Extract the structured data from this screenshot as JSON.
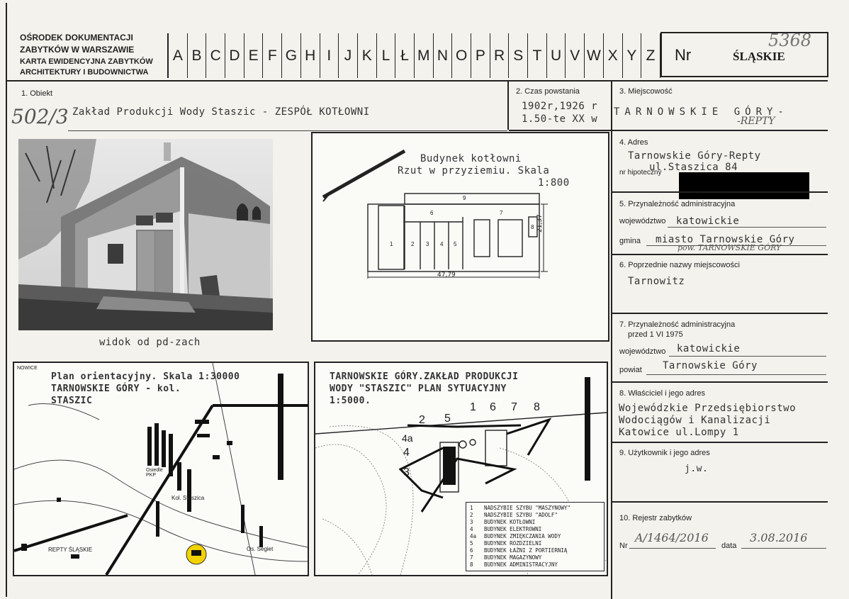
{
  "header": {
    "institution_lines": [
      "OŚRODEK DOKUMENTACJI",
      "ZABYTKÓW W WARSZAWIE",
      "KARTA EWIDENCYJNA ZABYTKÓW",
      "ARCHITEKTURY I BUDOWNICTWA"
    ],
    "alphabet": [
      "A",
      "B",
      "C",
      "D",
      "E",
      "F",
      "G",
      "H",
      "I",
      "J",
      "K",
      "L",
      "Ł",
      "M",
      "N",
      "O",
      "P",
      "R",
      "S",
      "T",
      "U",
      "V",
      "W",
      "X",
      "Y",
      "Z"
    ],
    "nr_label": "Nr",
    "region": "ŚLĄSKIE",
    "number_handwritten": "5368"
  },
  "fields": {
    "obiekt": {
      "label": "1. Obiekt",
      "value": "Zakład Produkcji Wody Staszic -  ZESPÓŁ  KOTŁOWNI",
      "handwritten_number": "502/3"
    },
    "czas": {
      "label": "2. Czas powstania",
      "line1": "1902r,1926 r",
      "line2": "1.50-te XX w"
    },
    "miejscowosc": {
      "label": "3. Miejscowość",
      "value": "TARNOWSKIE  GÓRY-",
      "handwritten": "-REPTY"
    },
    "adres": {
      "label": "4. Adres",
      "line1": "Tarnowskie Góry-Repty",
      "line2": "ul.Staszica 84",
      "hipoteczny_label": "nr hipoteczny"
    },
    "przynaleznosc": {
      "label": "5. Przynależność administracyjna",
      "wojewodztwo_label": "województwo",
      "wojewodztwo": "katowickie",
      "gmina_label": "gmina",
      "gmina": "miasto Tarnowskie Góry",
      "gmina_handwritten": "pow. TARNOWSKIE GÓRY"
    },
    "poprzednie": {
      "label": "6. Poprzednie nazwy miejscowości",
      "value": "Tarnowitz"
    },
    "przynaleznosc_1975": {
      "label_line1": "7. Przynależność administracyjna",
      "label_line2": "przed 1 VI 1975",
      "wojewodztwo_label": "województwo",
      "wojewodztwo": "katowickie",
      "powiat_label": "powiat",
      "powiat": "Tarnowskie Góry"
    },
    "wlasciciel": {
      "label": "8. Właściciel i jego adres",
      "line1": "Wojewódzkie Przedsiębiorstwo",
      "line2": "Wodociągów i Kanalizacji",
      "line3": "Katowice  ul.Lompy 1"
    },
    "uzytkownik": {
      "label": "9. Użytkownik i jego adres",
      "value": "j.w."
    },
    "rejestr": {
      "label": "10. Rejestr zabytków",
      "nr_label": "Nr",
      "nr_value": "A/1464/2016",
      "data_label": "data",
      "data_value": "3.08.2016"
    }
  },
  "photo": {
    "caption": "widok od pd-zach"
  },
  "floor_plan": {
    "title_line1": "Budynek kotłowni",
    "title_line2": "Rzut w przyziemiu. Skala",
    "title_line3": "1:800",
    "width_dim": "47,79",
    "depth_dim": "21,37",
    "rooms": [
      "1",
      "2",
      "3",
      "4",
      "5",
      "6",
      "7",
      "8",
      "9"
    ]
  },
  "orientation_map": {
    "title_line1": "Plan orientacyjny. Skala 1:30000",
    "title_line2": "TARNOWSKIE GÓRY - kol.",
    "title_line3": "STASZIC",
    "labels": [
      "Osiedle PKP",
      "Kol. Staszica",
      "Os. Segiet",
      "REPTY ŚLĄSKIE",
      "NOWICE"
    ]
  },
  "situation_plan": {
    "title_line1": "TARNOWSKIE GÓRY.ZAKŁAD PRODUKCJI",
    "title_line2": "WODY \"STASZIC\" PLAN SYTUACYJNY",
    "title_line3": "1:5000.",
    "markers": [
      "1",
      "2",
      "3",
      "4",
      "4a",
      "5",
      "6",
      "7",
      "8"
    ],
    "legend": [
      {
        "n": "1",
        "text": "NADSZYBIE SZYBU \"MASZYNOWY\""
      },
      {
        "n": "2",
        "text": "NADSZYBIE SZYBU \"ADOLF\""
      },
      {
        "n": "3",
        "text": "BUDYNEK KOTŁOWNI"
      },
      {
        "n": "4",
        "text": "BUDYNEK ELEKTROWNI"
      },
      {
        "n": "4a",
        "text": "BUDYNEK ZMIĘKCZANIA WODY"
      },
      {
        "n": "5",
        "text": "BUDYNEK ROZDZIELNI"
      },
      {
        "n": "6",
        "text": "BUDYNEK ŁAŹNI Z PORTIERNIĄ"
      },
      {
        "n": "7",
        "text": "BUDYNEK MAGAZYNOWY"
      },
      {
        "n": "8",
        "text": "BUDYNEK ADMINISTRACYJNY"
      }
    ]
  }
}
